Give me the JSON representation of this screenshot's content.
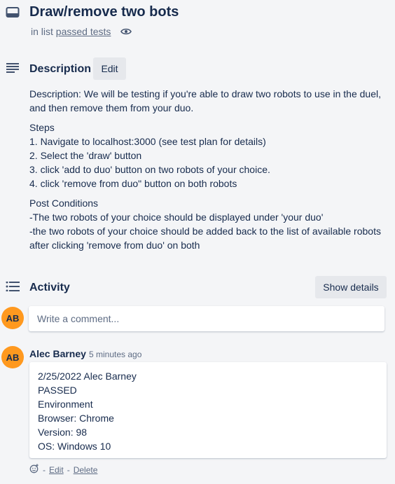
{
  "card": {
    "title": "Draw/remove two bots",
    "list_prefix": "in list",
    "list_name": "passed tests"
  },
  "description": {
    "heading": "Description",
    "edit_label": "Edit",
    "intro": "Description: We will be testing if you're able to draw two robots to use in the duel, and then remove them from your duo.",
    "steps_heading": "Steps",
    "steps": [
      "1. Navigate to localhost:3000 (see test plan for details)",
      "2. Select the 'draw' button",
      "3. click 'add to duo' button on two robots of your choice.",
      "4. click 'remove from duo\" button on both robots"
    ],
    "post_heading": "Post Conditions",
    "post": [
      "-The two robots of your choice should be displayed under 'your duo'",
      "-the two robots of your choice should be added back to the list of available robots after clicking 'remove from duo' on both"
    ]
  },
  "activity": {
    "heading": "Activity",
    "show_details_label": "Show details",
    "comment_placeholder": "Write a comment...",
    "avatar_initials": "AB",
    "comment": {
      "author": "Alec Barney",
      "time": "5 minutes ago",
      "initials": "AB",
      "lines": [
        "2/25/2022 Alec Barney",
        "PASSED",
        "Environment",
        "Browser: Chrome",
        "Version: 98",
        "OS: Windows 10"
      ],
      "separator": "-",
      "edit_label": "Edit",
      "delete_label": "Delete"
    }
  },
  "icons": {
    "card": "card-icon",
    "watch": "eye-icon",
    "description": "description-lines-icon",
    "activity": "activity-list-icon",
    "reaction": "add-reaction-icon"
  },
  "colors": {
    "background": "#f4f5f7",
    "avatar": "#ff991f",
    "text": "#172b4d",
    "muted": "#5e6c84"
  }
}
